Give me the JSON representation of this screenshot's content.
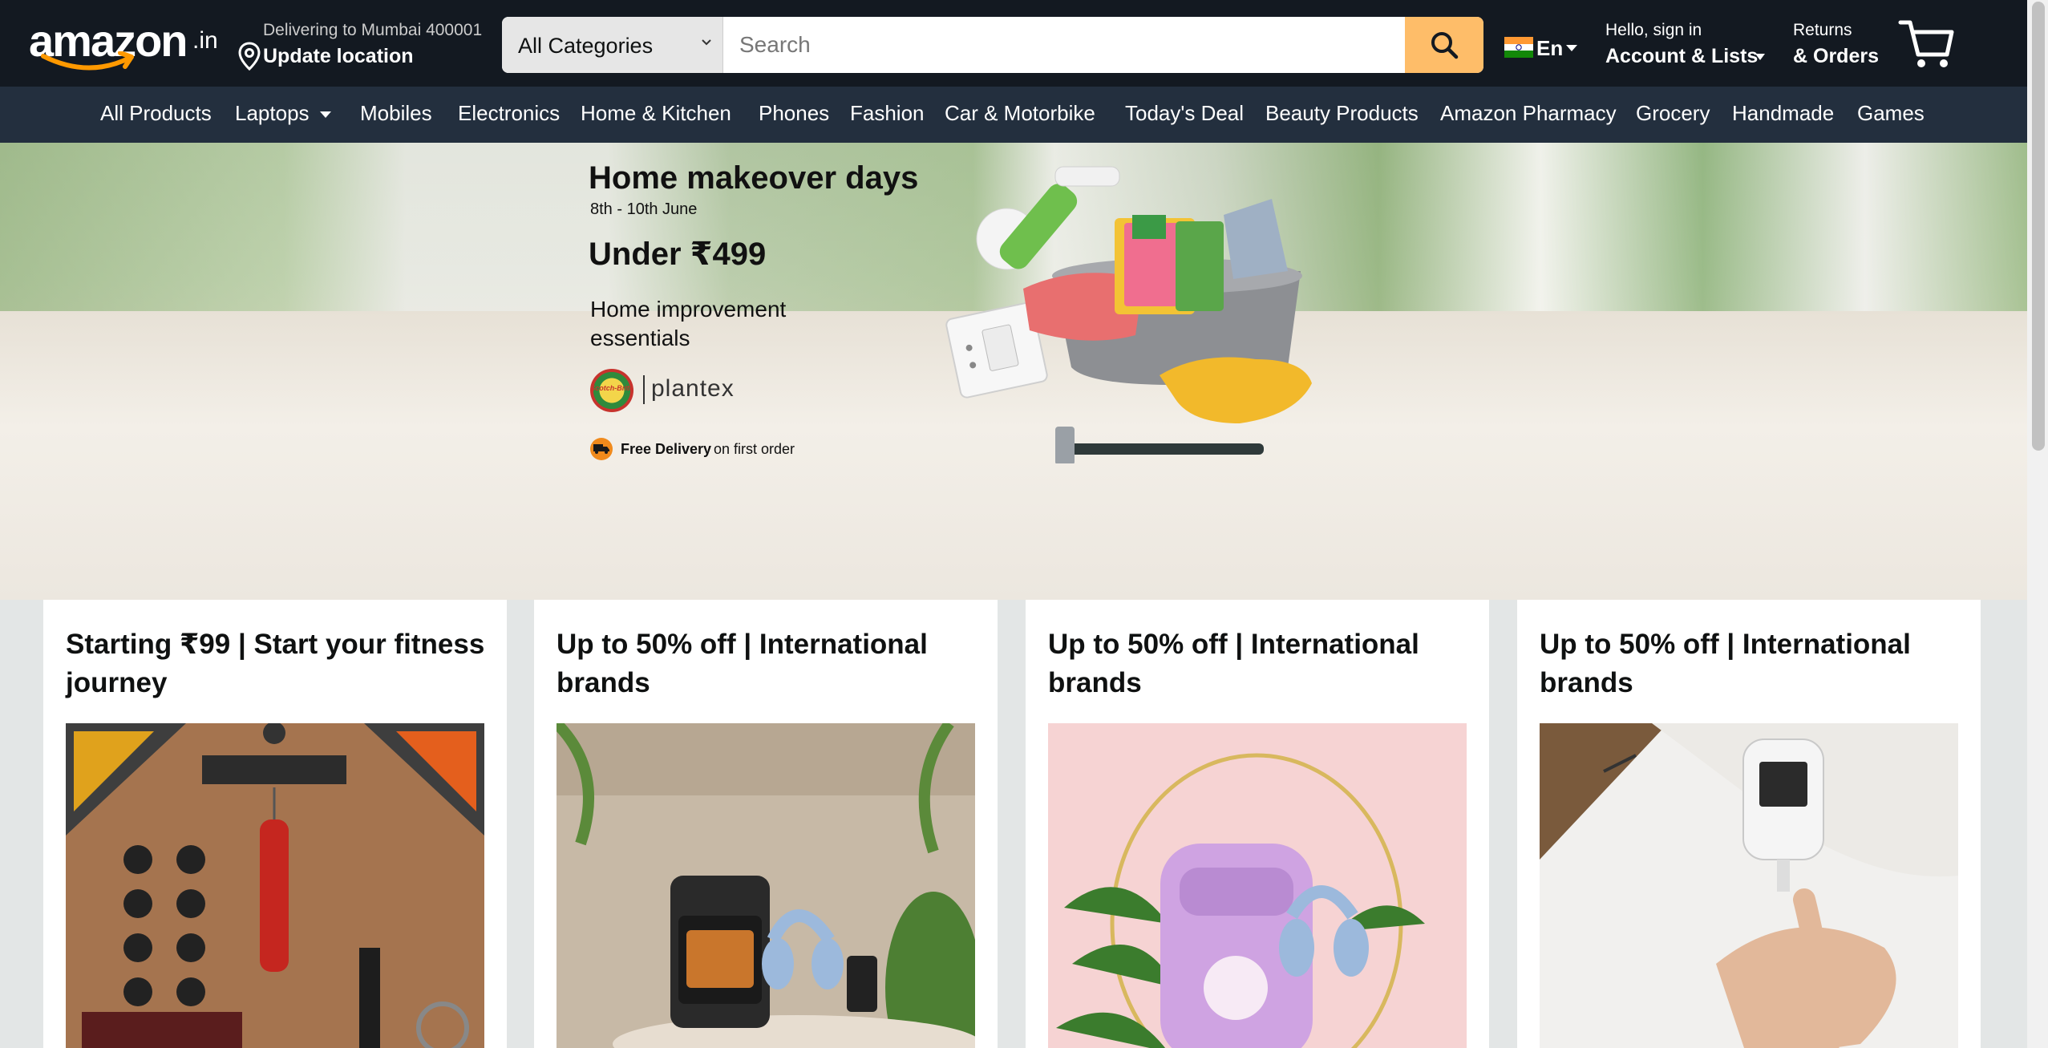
{
  "header": {
    "logo_text": "amazon",
    "logo_suffix": ".in",
    "deliver_line1": "Delivering to Mumbai 400001",
    "deliver_line2": "Update location",
    "search": {
      "category": "All Categories",
      "placeholder": "Search"
    },
    "language": "En",
    "account_line1": "Hello, sign in",
    "account_line2": "Account & Lists",
    "returns_line1": "Returns",
    "returns_line2": "& Orders"
  },
  "subnav": {
    "items": [
      {
        "label": "All Products"
      },
      {
        "label": "Laptops"
      },
      {
        "label": "Mobiles"
      },
      {
        "label": "Electronics"
      },
      {
        "label": "Home & Kitchen"
      },
      {
        "label": "Phones"
      },
      {
        "label": "Fashion"
      },
      {
        "label": "Car & Motorbike"
      },
      {
        "label": "Today's Deal"
      },
      {
        "label": "Beauty Products"
      },
      {
        "label": "Amazon Pharmacy"
      },
      {
        "label": "Grocery"
      },
      {
        "label": "Handmade"
      },
      {
        "label": "Games"
      }
    ]
  },
  "hero": {
    "title": "Home makeover days",
    "dates": "8th - 10th June",
    "price": "Under ₹499",
    "subtitle": "Home improvement essentials",
    "brand1": "Scotch-Brite",
    "brand2": "plantex",
    "delivery_strong": "Free Delivery",
    "delivery_rest": "on first order"
  },
  "cards": [
    {
      "title": "Starting ₹99 | Start your fitness journey"
    },
    {
      "title": "Up to 50% off | International brands"
    },
    {
      "title": "Up to 50% off | International brands"
    },
    {
      "title": "Up to 50% off | International brands"
    }
  ],
  "colors": {
    "header_bg": "#131921",
    "subnav_bg": "#232f3e",
    "search_button": "#febd69",
    "logo_smile": "#ff9900",
    "page_bg": "#e3e6e6"
  }
}
